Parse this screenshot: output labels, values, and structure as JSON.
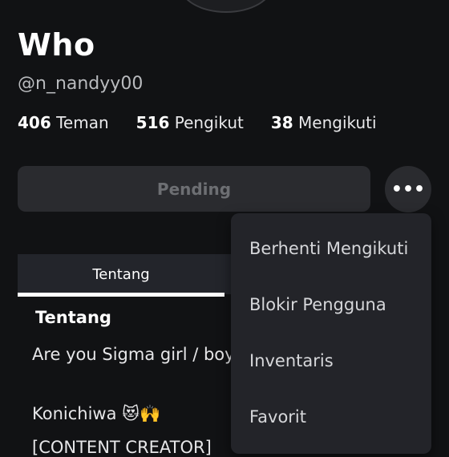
{
  "profile": {
    "display_name": "Who",
    "username": "@n_nandyy00"
  },
  "stats": [
    {
      "count": "406",
      "label": "Teman"
    },
    {
      "count": "516",
      "label": "Pengikut"
    },
    {
      "count": "38",
      "label": "Mengikuti"
    }
  ],
  "actions": {
    "pending_label": "Pending",
    "more_label": "•••"
  },
  "tabs": [
    {
      "label": "Tentang"
    }
  ],
  "about": {
    "title": "Tentang",
    "lines": [
      "Are you Sigma girl / boy",
      "Konichiwa 😻🙌",
      "[CONTENT CREATOR]"
    ]
  },
  "menu": {
    "items": [
      "Berhenti Mengikuti",
      "Blokir Pengguna",
      "Inventaris",
      "Favorit"
    ]
  }
}
